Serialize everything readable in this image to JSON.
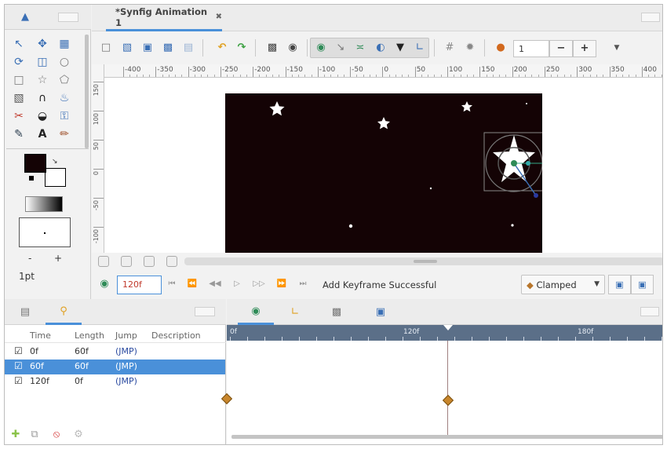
{
  "canvas_tab": {
    "title": "*Synfig Animation 1",
    "close": "✖"
  },
  "toolbar": {
    "zoom_value": "1",
    "minus": "−",
    "plus": "+"
  },
  "hruler": {
    "ticks": [
      "-400",
      "-350",
      "-300",
      "-250",
      "-200",
      "-150",
      "-100",
      "-50",
      "0",
      "50",
      "100",
      "150",
      "200",
      "250",
      "300",
      "350",
      "400"
    ]
  },
  "vruler": {
    "ticks": [
      "150",
      "100",
      "50",
      "0",
      "-50",
      "-100"
    ]
  },
  "tool_panel": {
    "width_value": "1pt",
    "minus": "-",
    "plus": "+"
  },
  "timebar": {
    "current_time": "120f",
    "status": "Add Keyframe Successful",
    "interpolation": "Clamped"
  },
  "keyframes": {
    "columns": [
      "Time",
      "Length",
      "Jump",
      "Description"
    ],
    "rows": [
      {
        "active": true,
        "time": "0f",
        "length": "60f",
        "jump": "(JMP)",
        "description": "",
        "selected": false
      },
      {
        "active": true,
        "time": "60f",
        "length": "60f",
        "jump": "(JMP)",
        "description": "",
        "selected": true
      },
      {
        "active": true,
        "time": "120f",
        "length": "0f",
        "jump": "(JMP)",
        "description": "",
        "selected": false
      }
    ]
  },
  "timeline": {
    "labels": [
      "0f",
      "120f",
      "180f"
    ]
  },
  "colors": {
    "accent": "#4a90d9",
    "canvas_bg": "#140305",
    "selected_row": "#4a90d9",
    "keyframe": "#c8862c"
  }
}
